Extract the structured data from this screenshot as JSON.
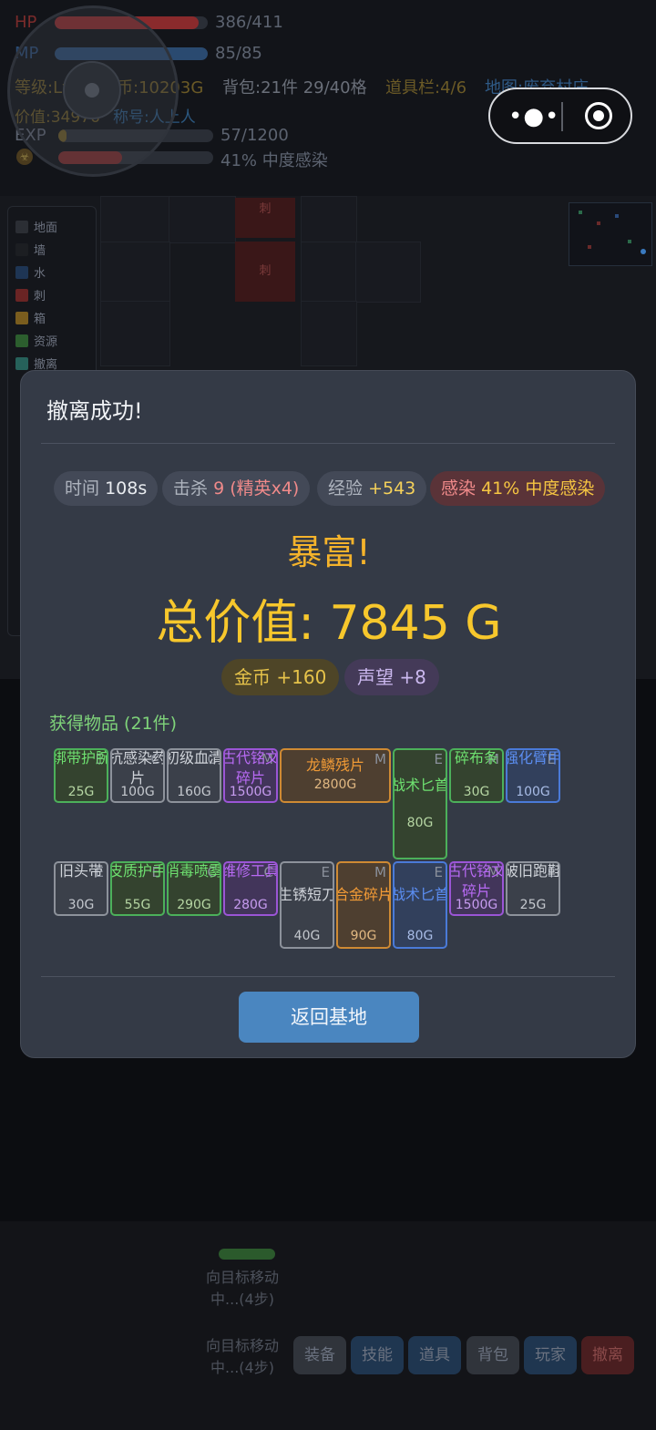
{
  "hud": {
    "hp_label": "HP",
    "hp_value": "386/411",
    "hp_fraction": 0.94,
    "mp_label": "MP",
    "mp_value": "85/85",
    "mp_fraction": 1.0,
    "level_text": "等级:Lv",
    "gold_text": "金币:10203G",
    "bag_text": "背包:21件 29/40格",
    "toolbar_text": "道具栏:4/6",
    "map_text": "地图:废弃村庄",
    "value_text": "价值:34976",
    "rank_text": "称号:人上人",
    "exp_label": "EXP",
    "exp_value": "57/1200",
    "exp_fraction": 0.05,
    "infect_value": "41% 中度感染",
    "infect_fraction": 0.41
  },
  "legend": [
    "地面",
    "墙",
    "水",
    "刺",
    "箱",
    "资源",
    "撤离"
  ],
  "legend_colors": [
    "#2b2e34",
    "#1c1e22",
    "#1e3554",
    "#6a2424",
    "#7a5d1e",
    "#2c5e2e",
    "#26615a"
  ],
  "map": {
    "spike_label": "刺"
  },
  "modal": {
    "title": "撤离成功!",
    "stats": {
      "time_label": "时间",
      "time_value": "108s",
      "kill_label": "击杀",
      "kill_value": "9 (精英x4)",
      "exp_label": "经验",
      "exp_value": "+543",
      "infect_label": "感染",
      "infect_value": "41% 中度感染"
    },
    "headline": "暴富!",
    "total": "总价值: 7845 G",
    "gold_label": "金币",
    "gold_value": "+160",
    "fame_label": "声望",
    "fame_value": "+8",
    "items_title": "获得物品 (21件)",
    "items": [
      {
        "name": "绑带护腕",
        "price": "25G",
        "rank": "E",
        "rarity": "green"
      },
      {
        "name": "抗感染药片",
        "price": "100G",
        "rank": "C",
        "rarity": "gray"
      },
      {
        "name": "初级血清",
        "price": "160G",
        "rank": "C",
        "rarity": "gray"
      },
      {
        "name": "古代铭文碎片",
        "price": "1500G",
        "rank": "M",
        "rarity": "purple"
      },
      {
        "name": "龙鳞残片",
        "price": "2800G",
        "rank": "M",
        "rarity": "orange"
      },
      {
        "name": "战术匕首",
        "price": "80G",
        "rank": "E",
        "rarity": "green"
      },
      {
        "name": "碎布条",
        "price": "30G",
        "rank": "M",
        "rarity": "green"
      },
      {
        "name": "强化臂甲",
        "price": "100G",
        "rank": "E",
        "rarity": "blue"
      },
      {
        "name": "旧头带",
        "price": "30G",
        "rank": "E",
        "rarity": "gray"
      },
      {
        "name": "皮质护手",
        "price": "55G",
        "rank": "E",
        "rarity": "green"
      },
      {
        "name": "消毒喷雾",
        "price": "290G",
        "rank": "C",
        "rarity": "green"
      },
      {
        "name": "维修工具",
        "price": "280G",
        "rank": "C",
        "rarity": "purple"
      },
      {
        "name": "生锈短刀",
        "price": "40G",
        "rank": "E",
        "rarity": "gray"
      },
      {
        "name": "合金碎片",
        "price": "90G",
        "rank": "M",
        "rarity": "orange"
      },
      {
        "name": "战术匕首",
        "price": "80G",
        "rank": "E",
        "rarity": "blue"
      },
      {
        "name": "古代铭文碎片",
        "price": "1500G",
        "rank": "M",
        "rarity": "purple"
      },
      {
        "name": "破旧跑鞋",
        "price": "25G",
        "rank": "E",
        "rarity": "gray"
      }
    ],
    "return_button": "返回基地"
  },
  "status_line_1": "向目标移动中...(4步)",
  "status_line_2": "向目标移动中...(4步)",
  "bottom_buttons": [
    "装备",
    "技能",
    "道具",
    "背包",
    "玩家",
    "撤离"
  ]
}
